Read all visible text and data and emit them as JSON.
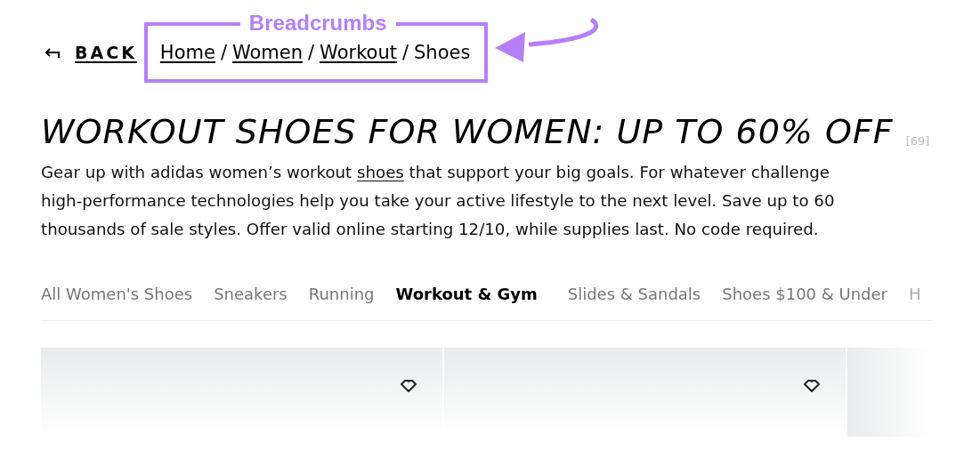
{
  "annotation": {
    "label": "Breadcrumbs"
  },
  "back": {
    "label": "BACK"
  },
  "breadcrumbs": [
    {
      "label": "Home",
      "link": true
    },
    {
      "separator": "/",
      "label": "Women",
      "link": true
    },
    {
      "separator": "/",
      "label": "Workout",
      "link": true
    },
    {
      "separator": "/",
      "label": "Shoes",
      "link": false
    }
  ],
  "heading": {
    "title": "WORKOUT SHOES FOR WOMEN: UP TO 60% OFF",
    "count": "[69]"
  },
  "description": {
    "before": "Gear up with adidas women’s workout ",
    "link": "shoes",
    "after": " that support your big goals. For whatever challenge",
    "lines": [
      "high-performance technologies help you take your active lifestyle to the next level. Save up to 60",
      "thousands of sale styles. Offer valid online starting 12/10, while supplies last. No code required."
    ]
  },
  "tabs": [
    {
      "label": "All Women's Shoes",
      "selected": false
    },
    {
      "label": "Sneakers",
      "selected": false
    },
    {
      "label": "Running",
      "selected": false
    },
    {
      "label": "Workout & Gym",
      "selected": true
    },
    {
      "label": "Slides & Sandals",
      "selected": false
    },
    {
      "label": "Shoes $100 & Under",
      "selected": false
    },
    {
      "label": "H",
      "selected": false
    }
  ],
  "products": [
    {
      "kind": "card"
    },
    {
      "kind": "card"
    },
    {
      "kind": "partial"
    }
  ]
}
